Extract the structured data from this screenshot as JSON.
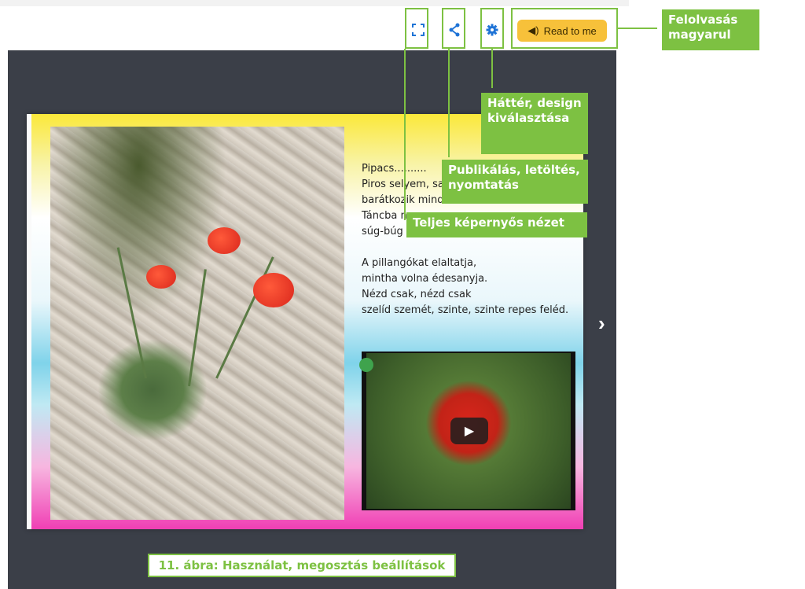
{
  "toolbar": {
    "fullscreen_icon": "fullscreen-icon",
    "share_icon": "share-icon",
    "settings_icon": "gear-icon",
    "read_button_label": "Read to me",
    "read_button_color": "#f7c13a"
  },
  "annotations": {
    "read_aloud": "Felolvasás magyarul",
    "background": "Háttér, design kiválasztása",
    "publish": "Publikálás, letöltés, nyomtatás",
    "fullscreen": "Teljes képernyős nézet",
    "accent_color": "#7dc142"
  },
  "poem": {
    "lines_1": [
      "Pipacs..........",
      "Piros selyem, sap",
      "barátkozik mind",
      "Táncba n",
      "súg-búg s"
    ],
    "lines_2": [
      "A pillangókat elaltatja,",
      "mintha volna édesanyja.",
      "Nézd csak, nézd csak",
      "szelíd szemét, szinte, szinte repes feléd."
    ]
  },
  "caption": "11. ábra: Használat, megosztás beállítások",
  "next_arrow": "›"
}
